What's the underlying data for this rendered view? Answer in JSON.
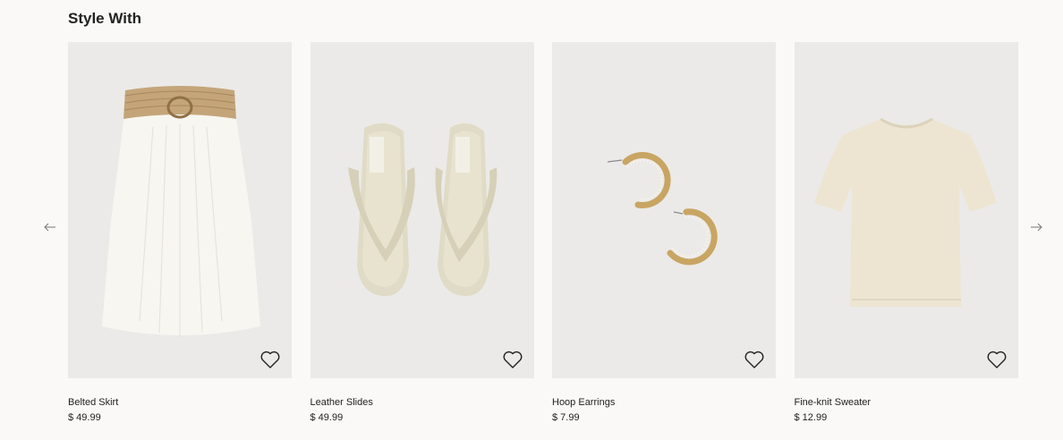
{
  "section": {
    "title": "Style With"
  },
  "navigation": {
    "prev_icon": "arrow-left-icon",
    "next_icon": "arrow-right-icon"
  },
  "products": [
    {
      "name": "Belted Skirt",
      "price": "$ 49.99",
      "favorite_icon": "heart-outline-icon"
    },
    {
      "name": "Leather Slides",
      "price": "$ 49.99",
      "favorite_icon": "heart-outline-icon"
    },
    {
      "name": "Hoop Earrings",
      "price": "$ 7.99",
      "favorite_icon": "heart-outline-icon"
    },
    {
      "name": "Fine-knit Sweater",
      "price": "$ 12.99",
      "favorite_icon": "heart-outline-icon"
    }
  ],
  "colors": {
    "page_background": "#faf9f8",
    "image_background": "#ebeae8",
    "text": "#222222"
  }
}
